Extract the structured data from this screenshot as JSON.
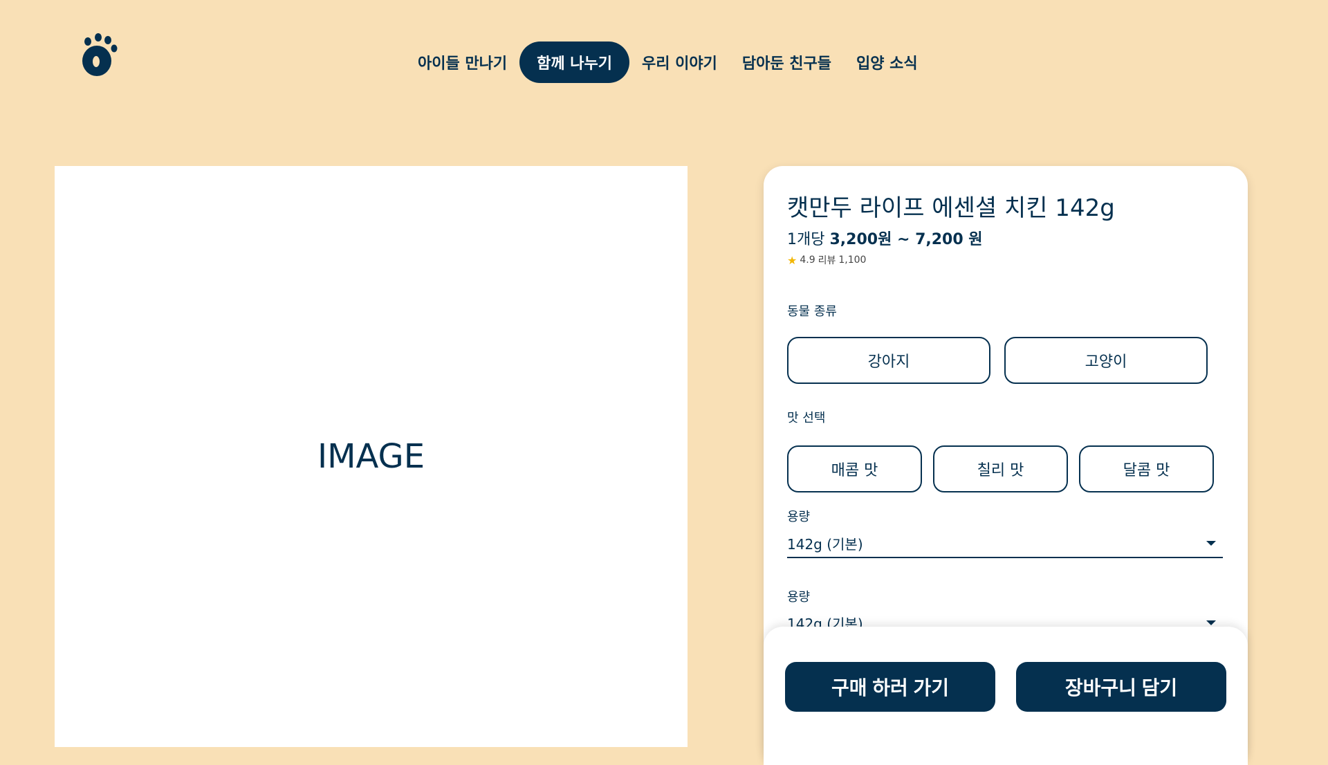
{
  "brand": {
    "logo_icon": "paw-icon",
    "color": "#05304f"
  },
  "nav": {
    "items": [
      {
        "label": "아이들 만나기"
      },
      {
        "label": "함께 나누기"
      },
      {
        "label": "우리 이야기"
      },
      {
        "label": "담아둔 친구들"
      },
      {
        "label": "입양 소식"
      }
    ],
    "active_index": 1
  },
  "image": {
    "placeholder": "IMAGE"
  },
  "product": {
    "title": "캣만두 라이프 에센셜 치킨 142g",
    "price_prefix": "1개당",
    "price_range": "3,200원 ~ 7,200 원",
    "rating_icon": "star-icon",
    "rating": "4.9",
    "review_label": "리뷰",
    "review_count": "1,100"
  },
  "options": {
    "animal": {
      "label": "동물 종류",
      "choices": [
        "강아지",
        "고양이"
      ]
    },
    "flavor": {
      "label": "맛 선택",
      "choices": [
        "매콤 맛",
        "칠리 맛",
        "달콤 맛"
      ]
    },
    "size1": {
      "label": "용량",
      "value": "142g (기본)"
    },
    "size2": {
      "label": "용량",
      "value": "142g (기본)"
    }
  },
  "actions": {
    "buy_label": "구매 하러 가기",
    "cart_label": "장바구니 담기"
  }
}
